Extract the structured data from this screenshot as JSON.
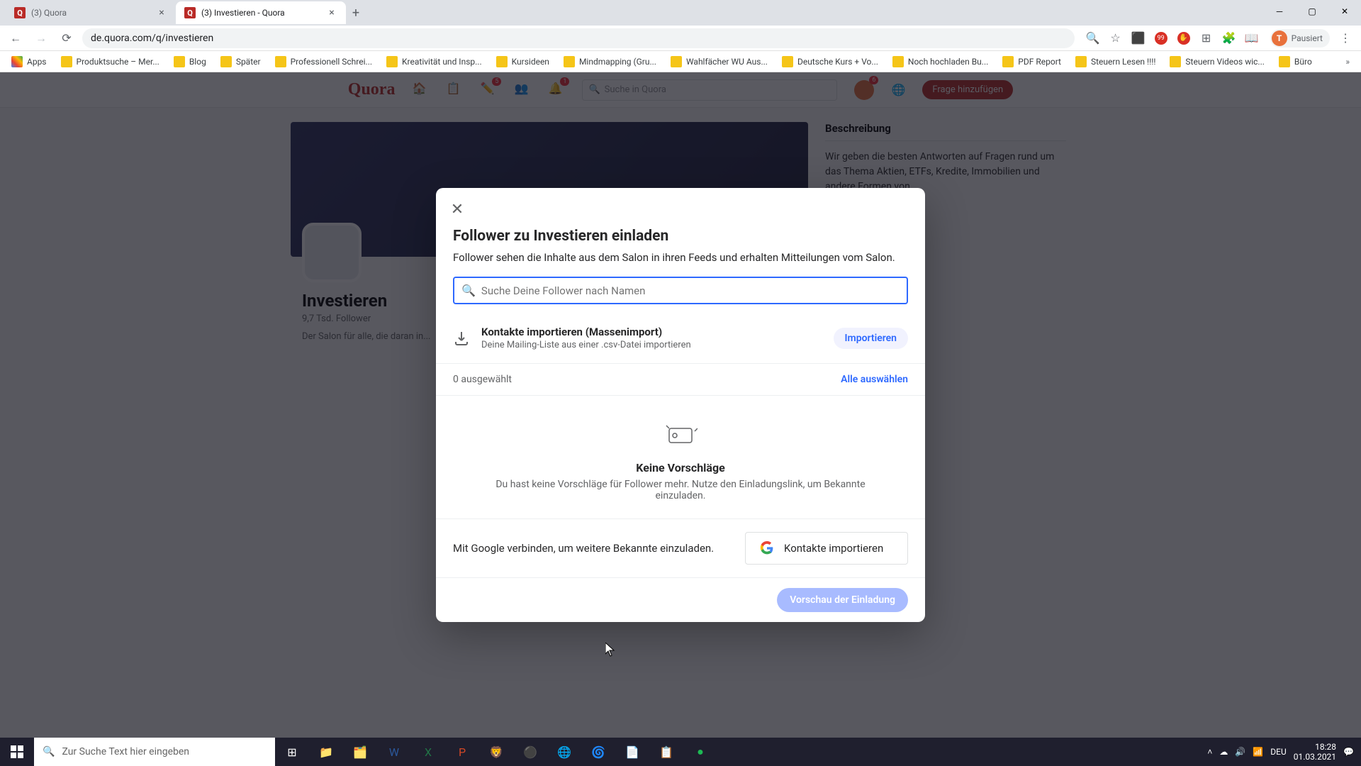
{
  "browser": {
    "tabs": [
      {
        "title": "(3) Quora"
      },
      {
        "title": "(3) Investieren - Quora"
      }
    ],
    "url": "de.quora.com/q/investieren",
    "profile_status": "Pausiert",
    "profile_initial": "T",
    "bookmarks": [
      "Apps",
      "Produktsuche – Mer...",
      "Blog",
      "Später",
      "Professionell Schrei...",
      "Kreativität und Insp...",
      "Kursideen",
      "Mindmapping (Gru...",
      "Wahlfächer WU Aus...",
      "Deutsche Kurs + Vo...",
      "Noch hochladen Bu...",
      "PDF Report",
      "Steuern Lesen !!!!",
      "Steuern Videos wic...",
      "Büro"
    ]
  },
  "quora": {
    "logo": "Quora",
    "search_placeholder": "Suche in Quora",
    "add_btn": "Frage hinzufügen",
    "space_title": "Investieren",
    "space_sub": "9,7 Tsd. Follower",
    "space_desc_line": "Der Salon für alle, die daran in...",
    "side_title": "Beschreibung",
    "side_body": "Wir geben die besten Antworten auf Fragen rund um das Thema Aktien, ETFs, Kredite, Immobilien und andere Formen von ..."
  },
  "modal": {
    "title": "Follower zu Investieren einladen",
    "desc": "Follower sehen die Inhalte aus dem Salon in ihren Feeds und erhalten Mitteilungen vom Salon.",
    "search_placeholder": "Suche Deine Follower nach Namen",
    "import_title": "Kontakte importieren (Massenimport)",
    "import_sub": "Deine Mailing-Liste aus einer .csv-Datei importieren",
    "import_btn": "Importieren",
    "selected_count": "0 ausgewählt",
    "select_all": "Alle auswählen",
    "empty_title": "Keine Vorschläge",
    "empty_sub": "Du hast keine Vorschläge für Follower mehr. Nutze den Einladungslink, um Bekannte einzuladen.",
    "google_text": "Mit Google verbinden, um weitere Bekannte einzuladen.",
    "google_btn": "Kontakte importieren",
    "preview_btn": "Vorschau der Einladung"
  },
  "taskbar": {
    "search_placeholder": "Zur Suche Text hier eingeben",
    "lang": "DEU",
    "time": "18:28",
    "date": "01.03.2021"
  }
}
